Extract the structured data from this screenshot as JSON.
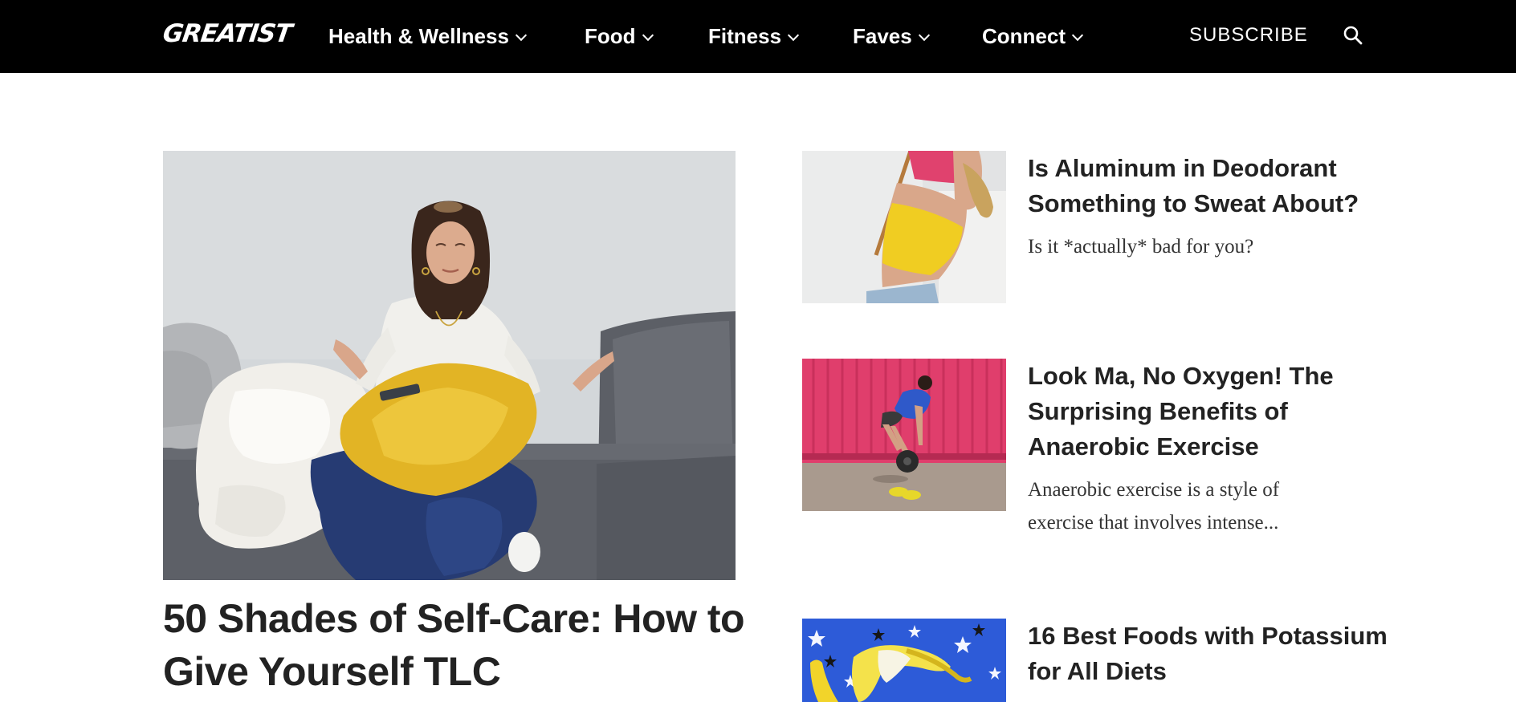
{
  "brand": {
    "logo_text": "GREATIST"
  },
  "nav": {
    "items": [
      {
        "label": "Health & Wellness"
      },
      {
        "label": "Food"
      },
      {
        "label": "Fitness"
      },
      {
        "label": "Faves"
      },
      {
        "label": "Connect"
      }
    ],
    "subscribe_label": "SUBSCRIBE",
    "search_icon": "search-icon"
  },
  "featured": {
    "title": "50 Shades of Self-Care: How to Give Yourself TLC"
  },
  "side_stories": [
    {
      "title": "Is Aluminum in Deodorant Something to Sweat About?",
      "dek": "Is it *actually* bad for you?"
    },
    {
      "title": "Look Ma, No Oxygen! The Surprising Benefits of Anaerobic Exercise",
      "dek": "Anaerobic exercise is a style of exercise that involves intense..."
    },
    {
      "title": "16 Best Foods with Potassium for All Diets",
      "dek": ""
    }
  ],
  "colors": {
    "header_bg": "#000000",
    "header_text": "#ffffff",
    "headline": "#222222"
  }
}
